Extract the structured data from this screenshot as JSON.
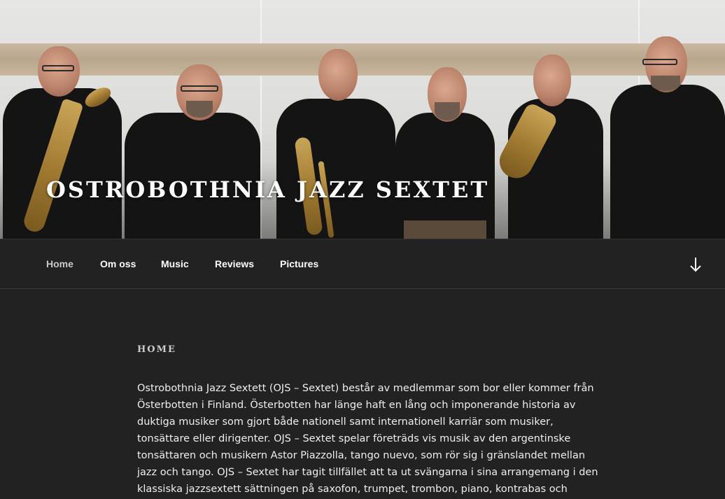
{
  "site": {
    "title": "OSTROBOTHNIA JAZZ SEXTET"
  },
  "nav": {
    "items": [
      {
        "label": "Home",
        "current": true
      },
      {
        "label": "Om oss",
        "current": false
      },
      {
        "label": "Music",
        "current": false
      },
      {
        "label": "Reviews",
        "current": false
      },
      {
        "label": "Pictures",
        "current": false
      }
    ],
    "scroll_icon": "arrow-down-icon"
  },
  "page": {
    "heading": "HOME",
    "body": "Ostrobothnia Jazz Sextett (OJS – Sextet) består av medlemmar som bor eller kommer från Österbotten i Finland. Österbotten har länge haft en lång och imponerande historia av duktiga musiker som gjort både nationell samt internationell karriär som musiker, tonsättare eller dirigenter. OJS – Sextet spelar företräds vis musik av den argentinske tonsättaren och musikern Astor Piazzolla, tango nuevo, som rör sig i gränslandet mellan jazz och tango. OJS – Sextet har tagit tillfället att ta ut svängarna i sina arrangemang i den klassiska jazzsextett sättningen på saxofon, trumpet, trombon, piano, kontrabas och"
  },
  "colors": {
    "background": "#222222",
    "text": "#eeeeee",
    "nav_current": "#c9c9c9"
  }
}
